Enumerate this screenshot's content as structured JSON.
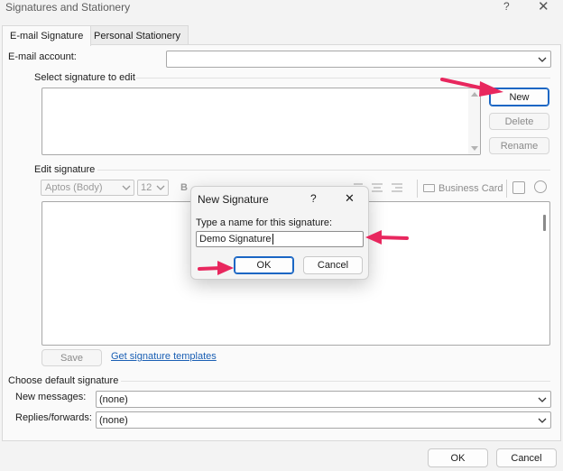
{
  "window": {
    "title": "Signatures and Stationery",
    "help": "?",
    "close": "✕"
  },
  "tabs": [
    {
      "label": "E-mail Signature",
      "active": true
    },
    {
      "label": "Personal Stationery",
      "active": false
    }
  ],
  "email_account": {
    "label": "E-mail account:",
    "value": ""
  },
  "select_section": {
    "label": "Select signature to edit"
  },
  "buttons": {
    "new": "New",
    "delete": "Delete",
    "rename": "Rename",
    "save": "Save",
    "ok": "OK",
    "cancel": "Cancel"
  },
  "edit_section": {
    "label": "Edit signature",
    "font": "Aptos (Body)",
    "size": "12",
    "bold": "B",
    "business_card": "Business Card",
    "templates_link": "Get signature templates"
  },
  "defaults": {
    "label": "Choose default signature",
    "new_messages_label": "New messages:",
    "new_messages_value": "(none)",
    "replies_label": "Replies/forwards:",
    "replies_value": "(none)"
  },
  "dialog": {
    "title": "New Signature",
    "help": "?",
    "close": "✕",
    "prompt": "Type a name for this signature:",
    "value": "Demo Signature",
    "ok": "OK",
    "cancel": "Cancel"
  },
  "colors": {
    "accent": "#1a66c4",
    "arrow": "#e8275e",
    "link": "#1a5fb4"
  }
}
